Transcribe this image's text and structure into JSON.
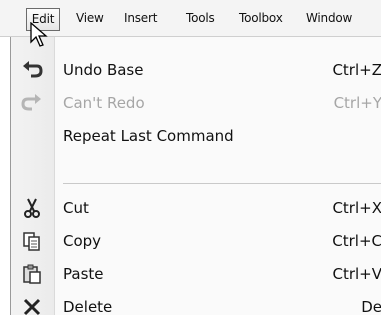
{
  "menubar": {
    "items": [
      {
        "label": "Edit",
        "active": true
      },
      {
        "label": "View"
      },
      {
        "label": "Insert"
      },
      {
        "label": "Tools"
      },
      {
        "label": "Toolbox"
      },
      {
        "label": "Window"
      }
    ]
  },
  "edit_menu": {
    "items": [
      {
        "label": "Undo Base",
        "shortcut": "Ctrl+Z",
        "icon": "undo-icon",
        "enabled": true
      },
      {
        "label": "Can't Redo",
        "shortcut": "Ctrl+Y",
        "icon": "redo-icon",
        "enabled": false
      },
      {
        "label": "Repeat Last Command",
        "shortcut": "",
        "icon": "",
        "enabled": true
      },
      {
        "label": "Cut",
        "shortcut": "Ctrl+X",
        "icon": "scissors-icon",
        "enabled": true
      },
      {
        "label": "Copy",
        "shortcut": "Ctrl+C",
        "icon": "copy-icon",
        "enabled": true
      },
      {
        "label": "Paste",
        "shortcut": "Ctrl+V",
        "icon": "paste-icon",
        "enabled": true
      },
      {
        "label": "Delete",
        "shortcut": "De",
        "icon": "delete-icon",
        "enabled": true
      }
    ]
  },
  "colors": {
    "disabled_text": "#a6a6a6",
    "menubar_bg": "#f4f4f4",
    "menu_bg": "#fafafa"
  }
}
